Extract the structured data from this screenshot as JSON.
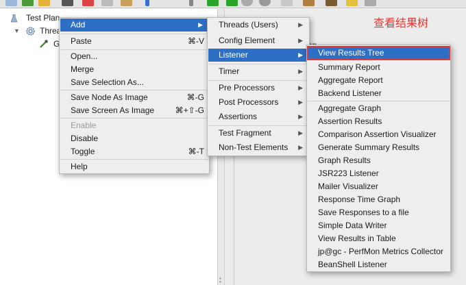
{
  "annotation": "查看结果树",
  "tree": {
    "root": "Test Plan",
    "thread_group": "Threa",
    "child": "G",
    "right_fragment": "an"
  },
  "context_menu": {
    "add": "Add",
    "paste": "Paste",
    "paste_sc": "⌘-V",
    "open": "Open...",
    "merge": "Merge",
    "save_selection": "Save Selection As...",
    "save_node_image": "Save Node As Image",
    "save_node_image_sc": "⌘-G",
    "save_screen_image": "Save Screen As Image",
    "save_screen_image_sc": "⌘+⇧-G",
    "enable": "Enable",
    "disable": "Disable",
    "toggle": "Toggle",
    "toggle_sc": "⌘-T",
    "help": "Help"
  },
  "add_menu": {
    "threads": "Threads (Users)",
    "config": "Config Element",
    "listener": "Listener",
    "timer": "Timer",
    "pre": "Pre Processors",
    "post": "Post Processors",
    "assertions": "Assertions",
    "fragment": "Test Fragment",
    "nontest": "Non-Test Elements"
  },
  "listener_menu": {
    "items_top": [
      "View Results Tree",
      "Summary Report",
      "Aggregate Report",
      "Backend Listener"
    ],
    "items_bottom": [
      "Aggregate Graph",
      "Assertion Results",
      "Comparison Assertion Visualizer",
      "Generate Summary Results",
      "Graph Results",
      "JSR223 Listener",
      "Mailer Visualizer",
      "Response Time Graph",
      "Save Responses to a file",
      "Simple Data Writer",
      "View Results in Table",
      "jp@gc - PerfMon Metrics Collector",
      "BeanShell Listener"
    ]
  },
  "colors": {
    "highlight": "#2d6fc4",
    "annotation": "#e8352e",
    "outline": "#e23a3a"
  }
}
